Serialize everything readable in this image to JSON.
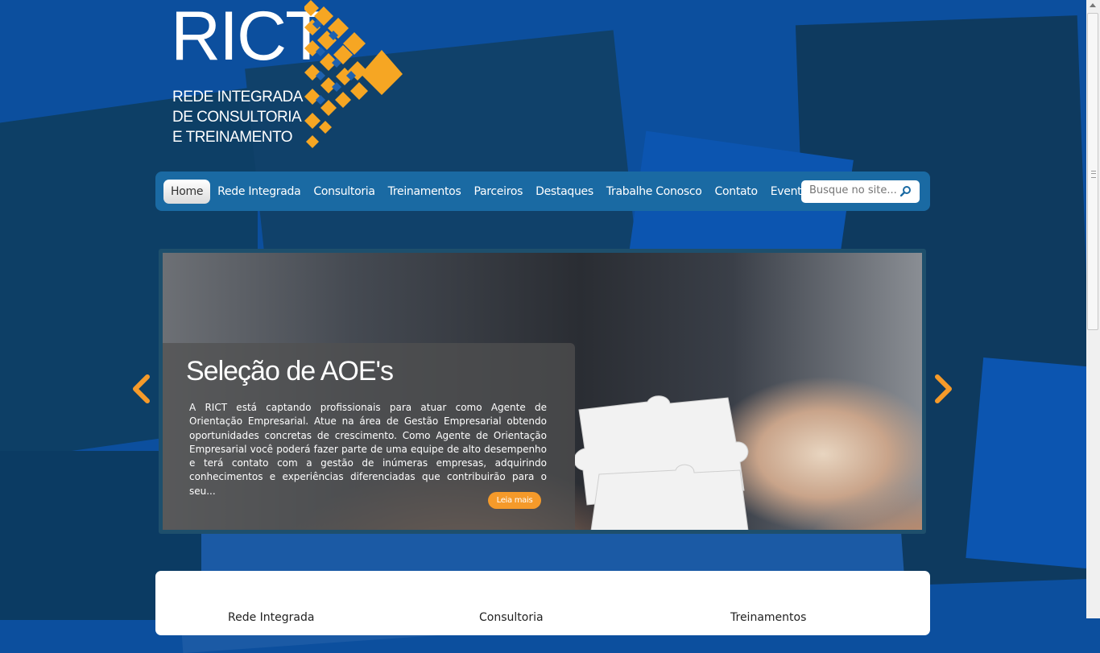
{
  "logo": {
    "name": "RICT",
    "line1": "REDE INTEGRADA",
    "line2": "DE CONSULTORIA",
    "line3": "E TREINAMENTO"
  },
  "nav": {
    "items": [
      {
        "label": "Home",
        "active": true
      },
      {
        "label": "Rede Integrada"
      },
      {
        "label": "Consultoria"
      },
      {
        "label": "Treinamentos"
      },
      {
        "label": "Parceiros"
      },
      {
        "label": "Destaques"
      },
      {
        "label": "Trabalhe Conosco"
      },
      {
        "label": "Contato"
      },
      {
        "label": "Eventos"
      }
    ],
    "search_placeholder": "Busque no site..."
  },
  "slider": {
    "title": "Seleção de AOE's",
    "text": "A RICT está captando profissionais para atuar como Agente de Orientação Empresarial. Atue na área de Gestão Empresarial obtendo oportunidades concretas de crescimento. Como Agente de Orientação Empresarial você poderá fazer parte de uma equipe de alto desempenho e terá contato com a gestão de inúmeras empresas, adquirindo conhecimentos e experiências diferenciadas que contribuirão para o seu...",
    "read_more": "Leia mais"
  },
  "content": {
    "columns": [
      "Rede Integrada",
      "Consultoria",
      "Treinamentos"
    ]
  },
  "colors": {
    "background": "#0c4f9e",
    "nav": "#1a6aa3",
    "accent": "#f59a2a"
  }
}
